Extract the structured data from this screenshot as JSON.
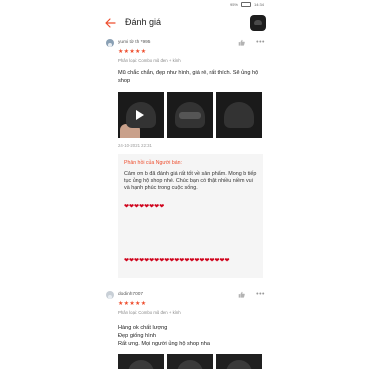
{
  "statusbar": {
    "network": "95%",
    "time": "14:34"
  },
  "header": {
    "title": "Đánh giá"
  },
  "reviews": [
    {
      "username": "yumi tờ th *995",
      "stars": "★★★★★",
      "variant": "Phân loại: Combo mũ đen + kính",
      "comment": "Mũ chắc chắn, đẹp như hình, giá rẻ,  rất thích. Sẽ ủng hộ shop",
      "date": "24-10-2021 22:31",
      "seller_reply_title": "Phản hồi của Người bán:",
      "seller_reply": "Cảm ơn b đã đánh giá rất tốt về sản phẩm. Mong b tiếp tục ủng hộ shop nhé. Chúc bạn có thật nhiều niềm vui và hạnh phúc trong cuộc sống.",
      "hearts_1": "❤❤❤❤❤❤❤❤",
      "hearts_2": "❤❤❤❤❤❤❤❤❤❤❤❤❤❤❤❤❤❤❤❤❤"
    },
    {
      "username": "dodinh7007",
      "stars": "★★★★★",
      "variant": "Phân loại: Combo mũ đen + kính",
      "comment": "Hàng ok chất lượng\nĐẹp giống hình\nRất ưng. Mọi người ủng hộ shop nha"
    }
  ],
  "icons": {
    "back": "back-arrow-icon",
    "like": "thumbs-up-icon",
    "more": "more-icon",
    "play": "play-icon"
  },
  "colors": {
    "accent": "#ee4d2d",
    "heart": "#d0021b"
  }
}
